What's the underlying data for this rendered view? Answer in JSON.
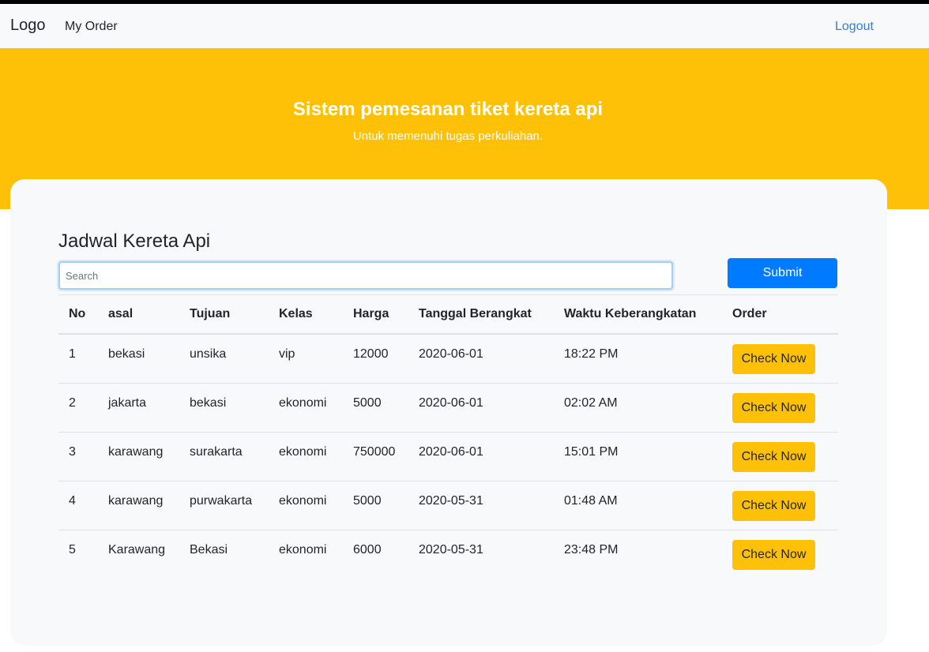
{
  "navbar": {
    "brand": "Logo",
    "my_order": "My Order",
    "logout": "Logout"
  },
  "hero": {
    "title": "Sistem pemesanan tiket kereta api",
    "subtitle": "Untuk memenuhi tugas perkuliahan."
  },
  "schedule": {
    "title": "Jadwal Kereta Api",
    "search_placeholder": "Search",
    "search_value": "",
    "submit_label": "Submit",
    "columns": [
      "No",
      "asal",
      "Tujuan",
      "Kelas",
      "Harga",
      "Tanggal Berangkat",
      "Waktu Keberangkatan",
      "Order"
    ],
    "rows": [
      {
        "no": "1",
        "asal": "bekasi",
        "tujuan": "unsika",
        "kelas": "vip",
        "harga": "12000",
        "tanggal": "2020-06-01",
        "waktu": "18:22 PM",
        "order": "Check Now"
      },
      {
        "no": "2",
        "asal": "jakarta",
        "tujuan": "bekasi",
        "kelas": "ekonomi",
        "harga": "5000",
        "tanggal": "2020-06-01",
        "waktu": "02:02 AM",
        "order": "Check Now"
      },
      {
        "no": "3",
        "asal": "karawang",
        "tujuan": "surakarta",
        "kelas": "ekonomi",
        "harga": "750000",
        "tanggal": "2020-06-01",
        "waktu": "15:01 PM",
        "order": "Check Now"
      },
      {
        "no": "4",
        "asal": "karawang",
        "tujuan": "purwakarta",
        "kelas": "ekonomi",
        "harga": "5000",
        "tanggal": "2020-05-31",
        "waktu": "01:48 AM",
        "order": "Check Now"
      },
      {
        "no": "5",
        "asal": "Karawang",
        "tujuan": "Bekasi",
        "kelas": "ekonomi",
        "harga": "6000",
        "tanggal": "2020-05-31",
        "waktu": "23:48 PM",
        "order": "Check Now"
      }
    ]
  },
  "colors": {
    "hero_bg": "#ffc107",
    "primary": "#007bff",
    "warning": "#ffc107",
    "navbar_bg": "#f8f9fa",
    "link": "#2e7fd6"
  }
}
